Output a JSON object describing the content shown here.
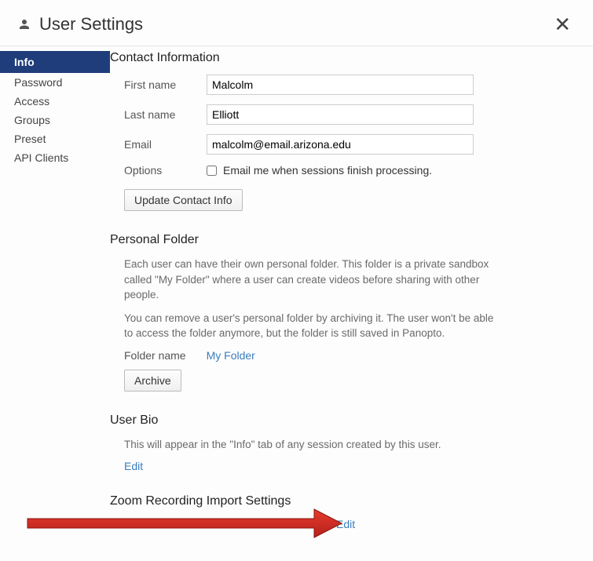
{
  "header": {
    "title": "User Settings"
  },
  "sidebar": {
    "items": [
      {
        "label": "Info",
        "active": true
      },
      {
        "label": "Password",
        "active": false
      },
      {
        "label": "Access",
        "active": false
      },
      {
        "label": "Groups",
        "active": false
      },
      {
        "label": "Preset",
        "active": false
      },
      {
        "label": "API Clients",
        "active": false
      }
    ]
  },
  "contact": {
    "title": "Contact Information",
    "first_name_label": "First name",
    "first_name": "Malcolm",
    "last_name_label": "Last name",
    "last_name": "Elliott",
    "email_label": "Email",
    "email": "malcolm@email.arizona.edu",
    "options_label": "Options",
    "options_checkbox_label": "Email me when sessions finish processing.",
    "options_checked": false,
    "update_button": "Update Contact Info"
  },
  "personal_folder": {
    "title": "Personal Folder",
    "desc1": "Each user can have their own personal folder. This folder is a private sandbox called \"My Folder\" where a user can create videos before sharing with other people.",
    "desc2": "You can remove a user's personal folder by archiving it. The user won't be able to access the folder anymore, but the folder is still saved in Panopto.",
    "folder_name_label": "Folder name",
    "folder_name_link": "My Folder",
    "archive_button": "Archive"
  },
  "user_bio": {
    "title": "User Bio",
    "desc": "This will appear in the \"Info\" tab of any session created by this user.",
    "edit_link": "Edit"
  },
  "zoom": {
    "title": "Zoom Recording Import Settings",
    "edit_link": "Edit"
  }
}
